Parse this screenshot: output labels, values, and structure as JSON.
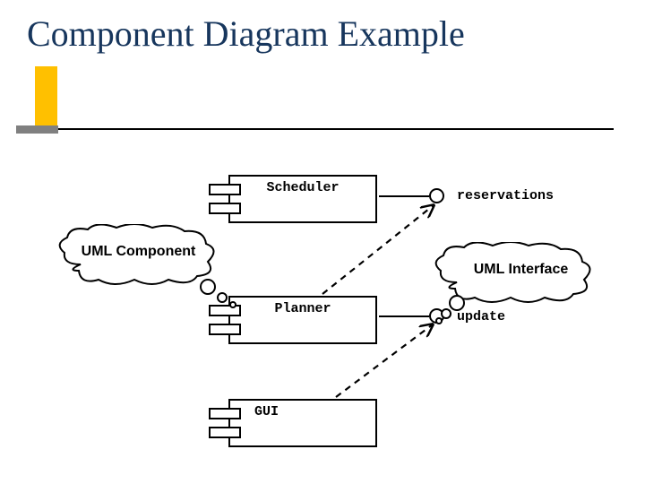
{
  "title": "Component Diagram Example",
  "components": {
    "scheduler": {
      "label": "Scheduler"
    },
    "planner": {
      "label": "Planner"
    },
    "gui": {
      "label": "GUI"
    }
  },
  "interfaces": {
    "reservations": {
      "label": "reservations"
    },
    "update": {
      "label": "update"
    }
  },
  "callouts": {
    "uml_component": {
      "label": "UML Component"
    },
    "uml_interface": {
      "label": "UML Interface"
    }
  }
}
